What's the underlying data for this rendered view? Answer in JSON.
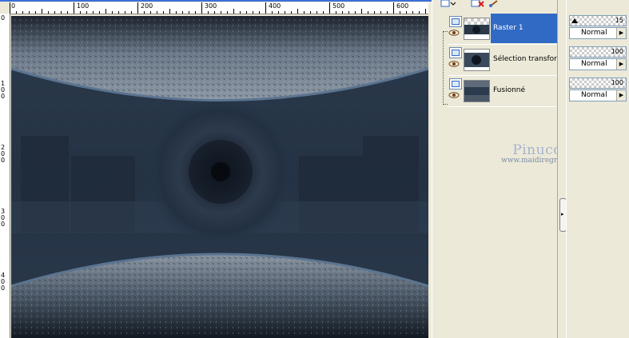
{
  "ruler": {
    "h_labels": [
      "0",
      "100",
      "200",
      "300",
      "400",
      "500",
      "600"
    ],
    "v_labels": [
      "0",
      "1",
      "0",
      "0",
      "2",
      "0",
      "0",
      "3",
      "0",
      "0",
      "4",
      "0",
      "0"
    ]
  },
  "layers": [
    {
      "name": "Raster 1",
      "selected": true,
      "opacity": "15",
      "blend": "Normal"
    },
    {
      "name": "Sélection transformé",
      "selected": false,
      "opacity": "100",
      "blend": "Normal"
    },
    {
      "name": "Fusionné",
      "selected": false,
      "opacity": "100",
      "blend": "Normal"
    }
  ],
  "watermark": {
    "name": "Pinuccia",
    "url": "www.maidiregrafica.eu"
  },
  "colors": {
    "selection": "#316ac5",
    "panel": "#ece9d8",
    "canvas_dark": "#1c2633",
    "arc_stroke": "#5b7490"
  },
  "icons": [
    "layer-icon",
    "eye-icon",
    "delete-layer-icon",
    "paint-brush-icon",
    "chevron-right-icon"
  ]
}
